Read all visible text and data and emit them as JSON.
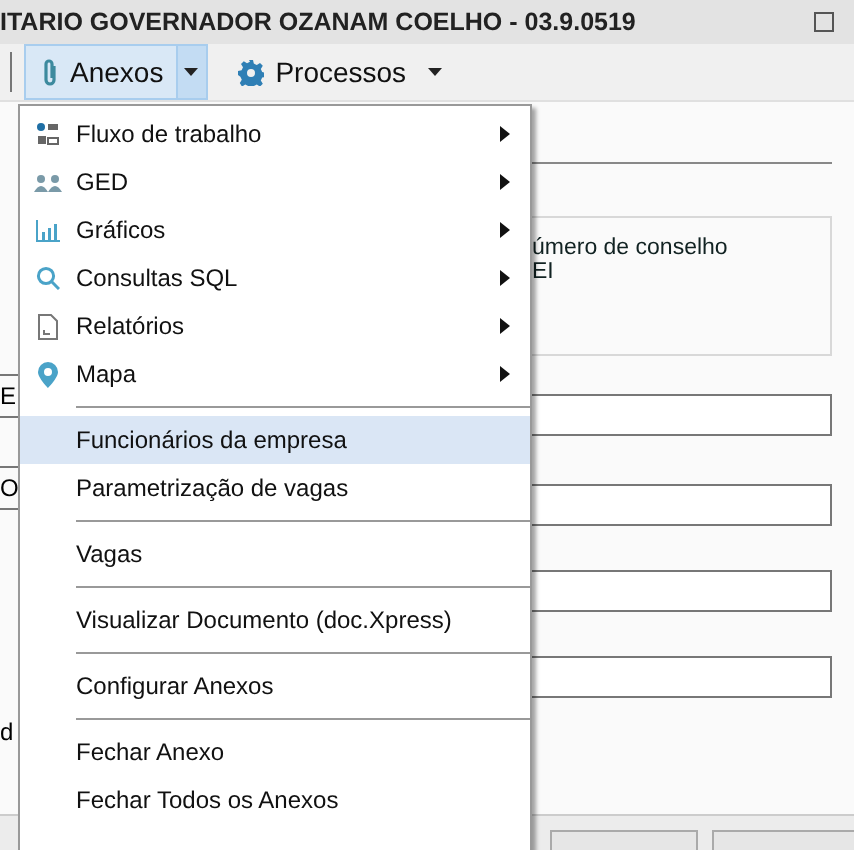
{
  "window": {
    "title": "ITARIO GOVERNADOR OZANAM COELHO - 03.9.0519"
  },
  "toolbar": [
    {
      "label": "Anexos",
      "selected": true
    },
    {
      "label": "Processos",
      "selected": false
    }
  ],
  "form": {
    "info_lines": [
      "úmero de conselho",
      "EI"
    ],
    "left_fields": [
      "E",
      "O"
    ],
    "left_label": "d"
  },
  "menu": [
    [
      {
        "label": "Fluxo de trabalho",
        "submenu": true,
        "highlighted": false
      },
      {
        "label": "GED",
        "submenu": true,
        "highlighted": false
      },
      {
        "label": "Gráficos",
        "submenu": true,
        "highlighted": false
      },
      {
        "label": "Consultas SQL",
        "submenu": true,
        "highlighted": false
      },
      {
        "label": "Relatórios",
        "submenu": true,
        "highlighted": false
      },
      {
        "label": "Mapa",
        "submenu": true,
        "highlighted": false
      }
    ],
    [
      {
        "label": "Funcionários da empresa",
        "submenu": false,
        "highlighted": true
      },
      {
        "label": "Parametrização de vagas",
        "submenu": false,
        "highlighted": false
      }
    ],
    [
      {
        "label": "Vagas",
        "submenu": false,
        "highlighted": false
      }
    ],
    [
      {
        "label": "Visualizar Documento (doc.Xpress)",
        "submenu": false,
        "highlighted": false
      }
    ],
    [
      {
        "label": "Configurar Anexos",
        "submenu": false,
        "highlighted": false
      }
    ],
    [
      {
        "label": "Fechar Anexo",
        "submenu": false,
        "highlighted": false
      },
      {
        "label": "Fechar Todos os Anexos",
        "submenu": false,
        "highlighted": false
      }
    ]
  ]
}
